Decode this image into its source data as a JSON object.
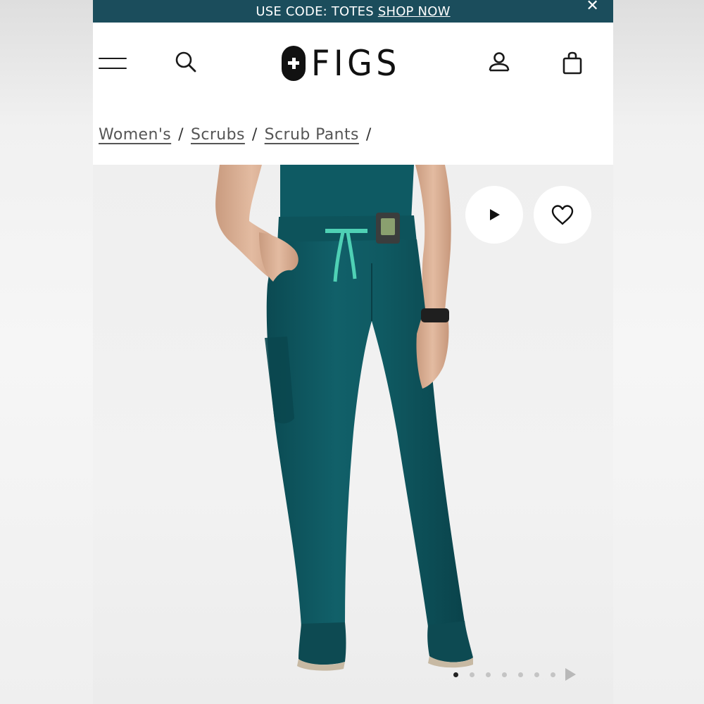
{
  "promo": {
    "text": "USE CODE: TOTES",
    "link": "SHOP NOW",
    "close": "✕"
  },
  "header": {
    "brand": "FIGS",
    "icons": [
      "hamburger-menu-icon",
      "search-icon",
      "account-icon",
      "shopping-bag-icon"
    ]
  },
  "breadcrumb": {
    "items": [
      "Women's",
      "Scrubs",
      "Scrub Pants"
    ],
    "separator": "/"
  },
  "gallery": {
    "image": "teal-scrub-pants-model",
    "actions": [
      "play-icon",
      "heart-icon"
    ],
    "slide_count": 8,
    "active_slide": 1
  },
  "colors": {
    "banner": "#1b4d5c",
    "scrub_teal": "#0f5a63",
    "drawstring": "#4fd1b5"
  }
}
